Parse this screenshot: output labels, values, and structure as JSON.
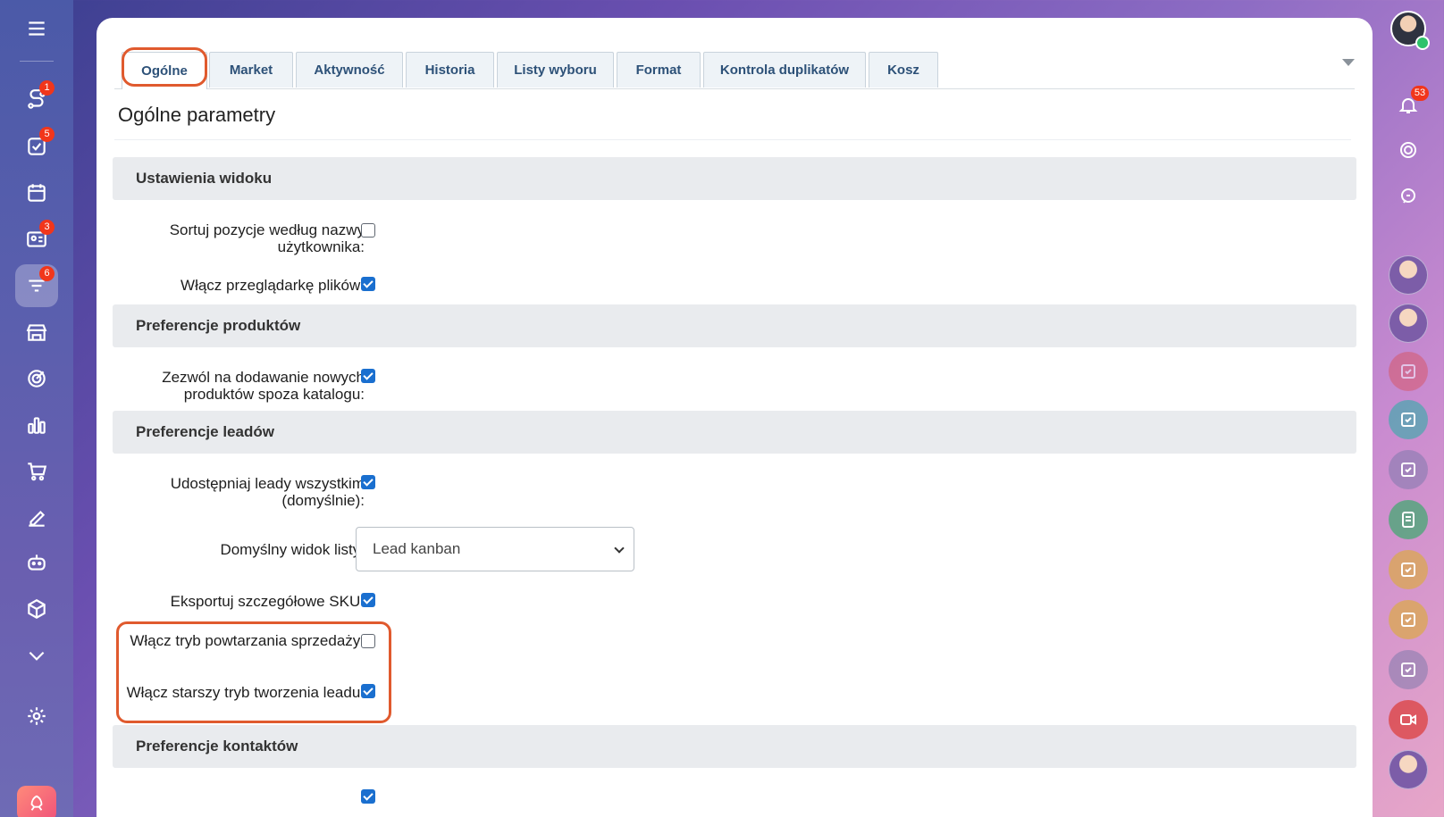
{
  "tabs": [
    {
      "label": "Ogólne"
    },
    {
      "label": "Market"
    },
    {
      "label": "Aktywność"
    },
    {
      "label": "Historia"
    },
    {
      "label": "Listy wyboru"
    },
    {
      "label": "Format"
    },
    {
      "label": "Kontrola duplikatów"
    },
    {
      "label": "Kosz"
    }
  ],
  "page_title": "Ogólne parametry",
  "sections": {
    "view": {
      "title": "Ustawienia widoku",
      "sort_label": "Sortuj pozycje według nazwy użytkownika:",
      "sort_checked": false,
      "viewer_label": "Włącz przeglądarkę plików:",
      "viewer_checked": true
    },
    "products": {
      "title": "Preferencje produktów",
      "allow_label": "Zezwól na dodawanie nowych produktów spoza katalogu:",
      "allow_checked": true
    },
    "leads": {
      "title": "Preferencje leadów",
      "share_label": "Udostępniaj leady wszystkim (domyślnie):",
      "share_checked": true,
      "default_view_label": "Domyślny widok listy:",
      "default_view_value": "Lead kanban",
      "export_label": "Eksportuj szczegółowe SKU:",
      "export_checked": true,
      "repeat_label": "Włącz tryb powtarzania sprzedaży:",
      "repeat_checked": false,
      "legacy_label": "Włącz starszy tryb tworzenia leadu:",
      "legacy_checked": true
    },
    "contacts": {
      "title": "Preferencje kontaktów"
    }
  },
  "left_sidebar": {
    "badges": {
      "sales": "1",
      "tasks": "5",
      "contacts": "3",
      "crm": "6"
    }
  },
  "right_sidebar": {
    "notifications_badge": "53"
  },
  "colors": {
    "accent": "#1a6fcf",
    "highlight": "#e05a2e",
    "badge": "#f1361b"
  }
}
